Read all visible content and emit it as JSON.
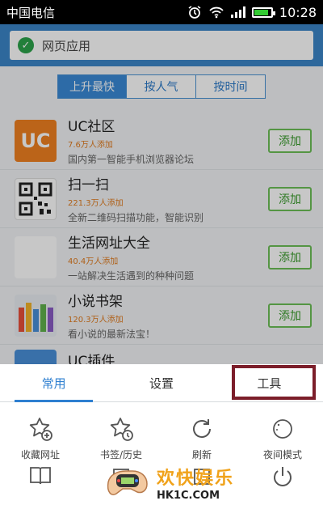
{
  "status_bar": {
    "carrier": "中国电信",
    "time": "10:28",
    "battery_level": 0.8
  },
  "address_bar": {
    "title": "网页应用",
    "icon": "shield-check-icon"
  },
  "sort_tabs": [
    {
      "label": "上升最快",
      "active": true
    },
    {
      "label": "按人气",
      "active": false
    },
    {
      "label": "按时间",
      "active": false
    }
  ],
  "apps": [
    {
      "name": "UC社区",
      "users": "7.6万人添加",
      "desc": "国内第一智能手机浏览器论坛",
      "add": "添加",
      "icon": "uc-logo-icon",
      "icon_text": "UC"
    },
    {
      "name": "扫一扫",
      "users": "221.3万人添加",
      "desc": "全新二维码扫描功能，智能识别",
      "add": "添加",
      "icon": "qr-code-icon"
    },
    {
      "name": "生活网址大全",
      "users": "40.4万人添加",
      "desc": "一站解决生活遇到的种种问题",
      "add": "添加",
      "icon": "life-links-icon"
    },
    {
      "name": "小说书架",
      "users": "120.3万人添加",
      "desc": "看小说的最新法宝！",
      "add": "添加",
      "icon": "bookshelf-icon"
    },
    {
      "name": "UC插件",
      "icon": "uc-plugin-icon"
    }
  ],
  "menu": {
    "tabs": [
      {
        "label": "常用",
        "active": true
      },
      {
        "label": "设置",
        "active": false
      },
      {
        "label": "工具",
        "active": false
      }
    ],
    "items": [
      {
        "label": "收藏网址",
        "icon": "star-add-icon"
      },
      {
        "label": "书签/历史",
        "icon": "star-clock-icon"
      },
      {
        "label": "刷新",
        "icon": "refresh-icon"
      },
      {
        "label": "夜间模式",
        "icon": "moon-icon"
      }
    ],
    "row2_icons": [
      "book-icon",
      "download-icon",
      "share-icon",
      "power-icon"
    ]
  },
  "watermark": {
    "cn": "欢快娱乐",
    "url": "HK1C.COM"
  },
  "colors": {
    "accent": "#2e7fd0",
    "add_green": "#6cbf57",
    "highlight": "#7c1e2a"
  }
}
